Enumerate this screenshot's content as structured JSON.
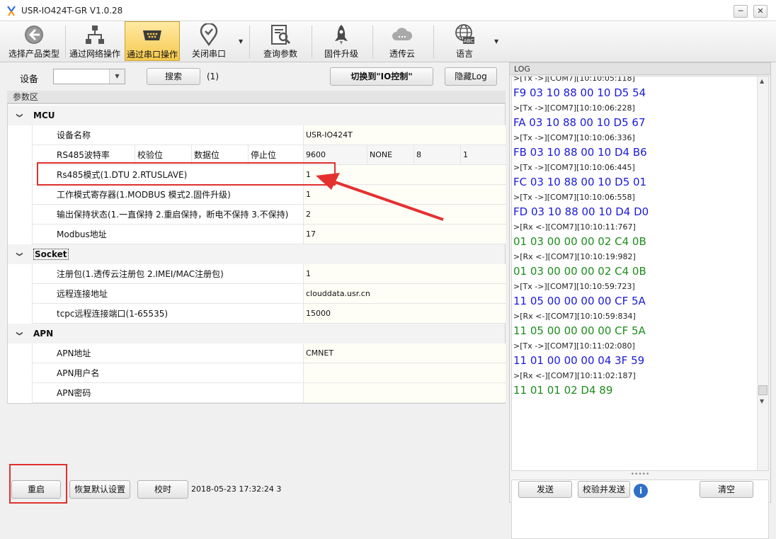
{
  "window": {
    "title": "USR-IO424T-GR V1.0.28",
    "min_label": "─",
    "close_label": "✕"
  },
  "toolbar": {
    "buttons": [
      {
        "label": "选择产品类型",
        "icon": "back-arrow-icon"
      },
      {
        "label": "通过网络操作",
        "icon": "network-icon"
      },
      {
        "label": "通过串口操作",
        "icon": "serial-port-icon",
        "active": true
      },
      {
        "label": "关闭串口",
        "icon": "location-check-icon"
      },
      {
        "label": "查询参数",
        "icon": "query-icon"
      },
      {
        "label": "固件升级",
        "icon": "rocket-icon"
      },
      {
        "label": "透传云",
        "icon": "cloud-icon"
      },
      {
        "label": "语言",
        "icon": "globe-abc-icon"
      }
    ]
  },
  "device_bar": {
    "device_label": "设备",
    "device_value": "",
    "search_label": "搜索",
    "count": "(1)",
    "switch_label": "切换到\"IO控制\"",
    "hide_log_label": "隐藏Log"
  },
  "params": {
    "header": "参数区",
    "mcu": {
      "title": "MCU",
      "device_name_label": "设备名称",
      "device_name_value": "USR-IO424T",
      "serial_labels": [
        "RS485波特率",
        "校验位",
        "数据位",
        "停止位"
      ],
      "serial_values": [
        "9600",
        "NONE",
        "8",
        "1"
      ],
      "rows": [
        {
          "key": "Rs485模式(1.DTU 2.RTUSLAVE)",
          "value": "1"
        },
        {
          "key": "工作模式寄存器(1.MODBUS 模式2.固件升级)",
          "value": "1"
        },
        {
          "key": "输出保持状态(1.一直保持 2.重启保持，断电不保持 3.不保持)",
          "value": "2"
        },
        {
          "key": "Modbus地址",
          "value": "17"
        }
      ]
    },
    "socket": {
      "title": "Socket",
      "rows": [
        {
          "key": "注册包(1.透传云注册包 2.IMEI/MAC注册包)",
          "value": "1"
        },
        {
          "key": "远程连接地址",
          "value": "clouddata.usr.cn"
        },
        {
          "key": "tcpc远程连接端口(1-65535)",
          "value": "15000"
        }
      ]
    },
    "apn": {
      "title": "APN",
      "rows": [
        {
          "key": "APN地址",
          "value": "CMNET"
        },
        {
          "key": "APN用户名",
          "value": ""
        },
        {
          "key": "APN密码",
          "value": ""
        }
      ]
    }
  },
  "footer": {
    "restart_label": "重启",
    "restore_label": "恢复默认设置",
    "timesync_label": "校时",
    "timestamp": "2018-05-23 17:32:24 3"
  },
  "log": {
    "title": "LOG",
    "lines": [
      {
        "type": "meta",
        "text": ">[Tx ->][COM7][10:10:05:118]"
      },
      {
        "type": "tx",
        "text": "F9 03 10 88 00 10 D5 54"
      },
      {
        "type": "meta",
        "text": ">[Tx ->][COM7][10:10:06:228]"
      },
      {
        "type": "tx",
        "text": "FA 03 10 88 00 10 D5 67"
      },
      {
        "type": "meta",
        "text": ">[Tx ->][COM7][10:10:06:336]"
      },
      {
        "type": "tx",
        "text": "FB 03 10 88 00 10 D4 B6"
      },
      {
        "type": "meta",
        "text": ">[Tx ->][COM7][10:10:06:445]"
      },
      {
        "type": "tx",
        "text": "FC 03 10 88 00 10 D5 01"
      },
      {
        "type": "meta",
        "text": ">[Tx ->][COM7][10:10:06:558]"
      },
      {
        "type": "tx",
        "text": "FD 03 10 88 00 10 D4 D0"
      },
      {
        "type": "meta",
        "text": ">[Rx <-][COM7][10:10:11:767]"
      },
      {
        "type": "rx",
        "text": "01 03 00 00 00 02 C4 0B"
      },
      {
        "type": "meta",
        "text": ">[Rx <-][COM7][10:10:19:982]"
      },
      {
        "type": "rx",
        "text": "01 03 00 00 00 02 C4 0B"
      },
      {
        "type": "meta",
        "text": ">[Tx ->][COM7][10:10:59:723]"
      },
      {
        "type": "tx",
        "text": "11 05 00 00 00 00 CF 5A"
      },
      {
        "type": "meta",
        "text": ">[Rx <-][COM7][10:10:59:834]"
      },
      {
        "type": "rx",
        "text": "11 05 00 00 00 00 CF 5A"
      },
      {
        "type": "meta",
        "text": ">[Tx ->][COM7][10:11:02:080]"
      },
      {
        "type": "tx",
        "text": "11 01 00 00 00 04 3F 59"
      },
      {
        "type": "meta",
        "text": ">[Rx <-][COM7][10:11:02:187]"
      },
      {
        "type": "rx",
        "text": "11 01 01 02 D4 89"
      }
    ],
    "send_label": "发送",
    "verify_send_label": "校验并发送",
    "info_label": "i",
    "clear_label": "清空"
  }
}
